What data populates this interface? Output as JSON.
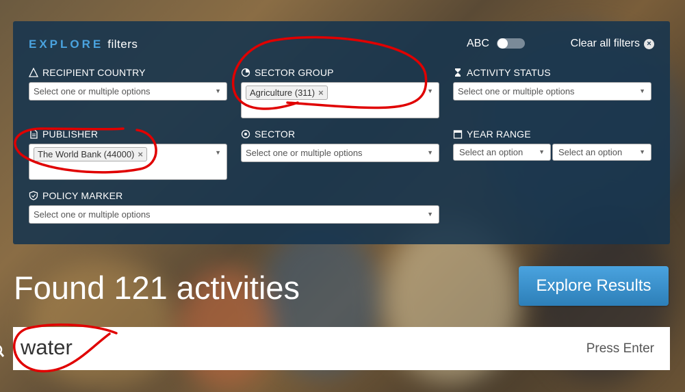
{
  "panel": {
    "title_strong": "EXPLORE",
    "title_rest": "filters",
    "abc_label": "ABC",
    "clear_all": "Clear all filters",
    "clear_icon": "×"
  },
  "filters": {
    "recipient_country": {
      "label": "RECIPIENT COUNTRY",
      "placeholder": "Select one or multiple options"
    },
    "sector_group": {
      "label": "SECTOR GROUP",
      "tag": "Agriculture (311)"
    },
    "activity_status": {
      "label": "ACTIVITY STATUS",
      "placeholder": "Select one or multiple options"
    },
    "publisher": {
      "label": "PUBLISHER",
      "tag": "The World Bank (44000)"
    },
    "sector": {
      "label": "SECTOR",
      "placeholder": "Select one or multiple options"
    },
    "year_range": {
      "label": "YEAR RANGE",
      "from_placeholder": "Select an option",
      "to_placeholder": "Select an option"
    },
    "policy_marker": {
      "label": "POLICY MARKER",
      "placeholder": "Select one or multiple options"
    }
  },
  "results": {
    "found_text": "Found 121 activities",
    "explore_button": "Explore Results"
  },
  "search": {
    "value": "water",
    "hint": "Press Enter"
  },
  "colors": {
    "accent": "#4aa3df",
    "panel_bg": "#16344e",
    "annotation": "#e00000"
  },
  "tag_remove_glyph": "×",
  "dropdown_glyph": "▼"
}
